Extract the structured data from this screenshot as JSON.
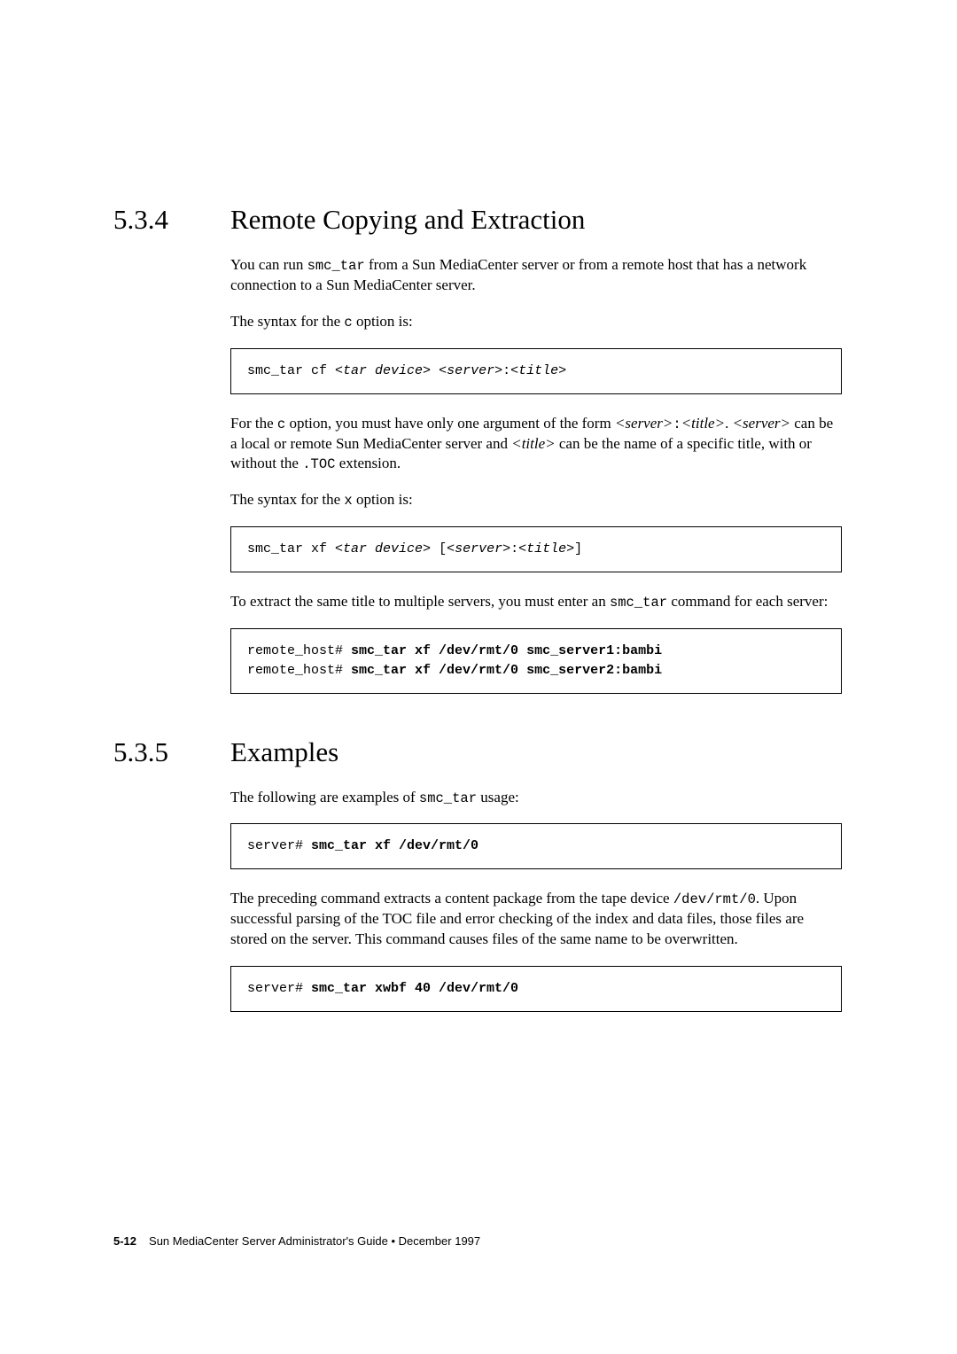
{
  "section534": {
    "num": "5.3.4",
    "title": "Remote Copying and Extraction",
    "p1a": "You can run ",
    "p1b": "smc_tar",
    "p1c": " from a Sun MediaCenter server or from a remote host that has a network connection to a Sun MediaCenter server.",
    "p2a": "The syntax for the ",
    "p2b": "c",
    "p2c": " option is:",
    "code1a": "smc_tar cf ",
    "code1b": "<tar device>",
    "code1c": " ",
    "code1d": "<server>",
    "code1e": ":",
    "code1f": "<title>",
    "p3a": "For the ",
    "p3b": "c",
    "p3c": " option, you must have only one argument of the form ",
    "p3d": "<server>",
    "p3e": ":",
    "p3f": "<title>",
    "p3g": ". ",
    "p3h": "<server>",
    "p3i": " can be a local or remote Sun MediaCenter server and ",
    "p3j": "<title>",
    "p3k": " can be the name of a specific title, with or without the ",
    "p3l": ".TOC",
    "p3m": " extension.",
    "p4a": "The syntax for the ",
    "p4b": "x",
    "p4c": " option is:",
    "code2a": "smc_tar xf ",
    "code2b": "<tar device>",
    "code2c": " [",
    "code2d": "<server>",
    "code2e": ":",
    "code2f": "<title>",
    "code2g": "]",
    "p5a": "To extract the same title to multiple servers, you must enter an ",
    "p5b": "smc_tar",
    "p5c": " command for each server:",
    "code3a": "remote_host# ",
    "code3b": "smc_tar xf /dev/rmt/0 smc_server1:bambi",
    "code3c": "remote_host# ",
    "code3d": "smc_tar xf /dev/rmt/0 smc_server2:bambi"
  },
  "section535": {
    "num": "5.3.5",
    "title": "Examples",
    "p1a": "The following are examples of ",
    "p1b": "smc_tar",
    "p1c": " usage:",
    "code1a": "server# ",
    "code1b": "smc_tar xf /dev/rmt/0",
    "p2a": "The preceding command extracts a content package from the tape device ",
    "p2b": "/dev/rmt/0",
    "p2c": ". Upon successful parsing of the TOC file and error checking of the index and data files, those files are stored on the server. This command causes files of the same name to be overwritten.",
    "code2a": "server# ",
    "code2b": "smc_tar xwbf 40 /dev/rmt/0"
  },
  "footer": {
    "pagenum": "5-12",
    "text": "Sun MediaCenter Server Administrator's Guide • December 1997"
  }
}
